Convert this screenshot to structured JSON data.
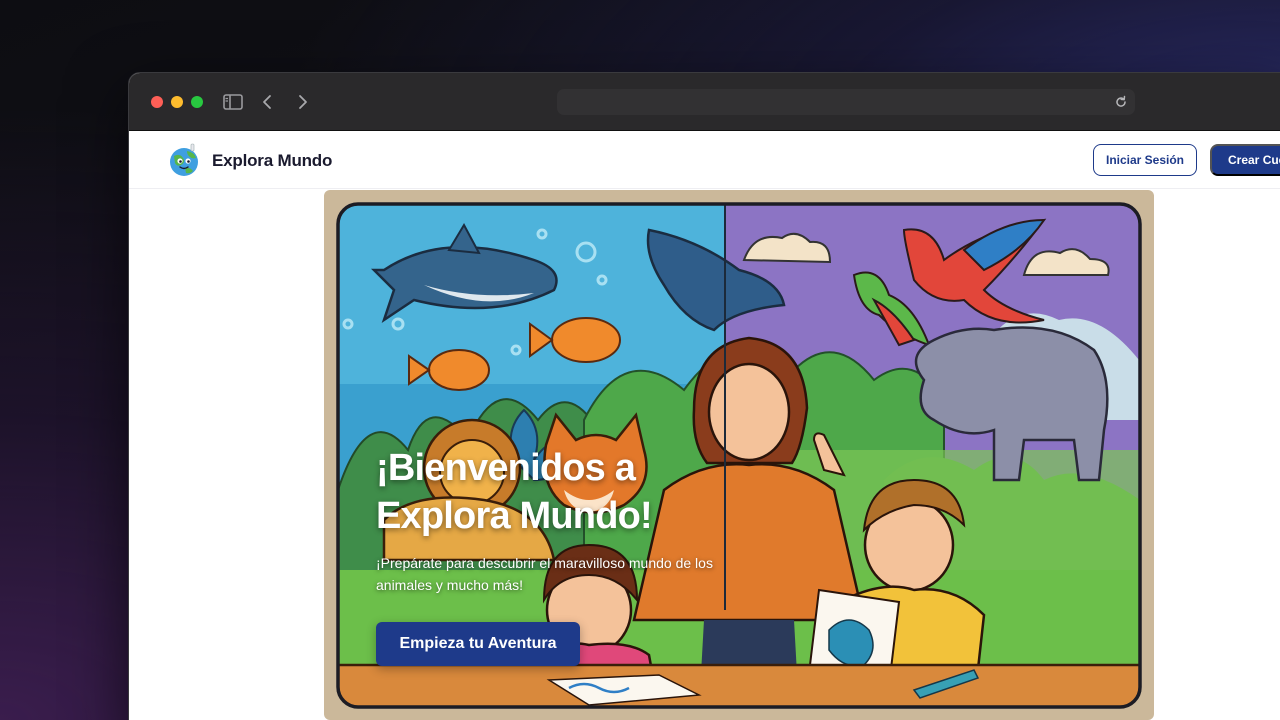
{
  "browser": {
    "url": "",
    "icons": [
      "sidebar-icon",
      "chevron-left-icon",
      "chevron-right-icon",
      "reload-icon"
    ]
  },
  "header": {
    "brand": "Explora Mundo",
    "logo_icon": "globe-mascot-icon",
    "login_label": "Iniciar Sesión",
    "signup_label": "Crear Cue"
  },
  "hero": {
    "title": "¡Bienvenidos a Explora Mundo!",
    "subtitle": "¡Prepárate para descubrir el maravilloso mundo de los animales y mucho más!",
    "cta_label": "Empieza tu Aventura"
  },
  "colors": {
    "primary": "#1e3a8a",
    "hero_frame": "#cbb89a",
    "titlebar": "#2a292b"
  }
}
